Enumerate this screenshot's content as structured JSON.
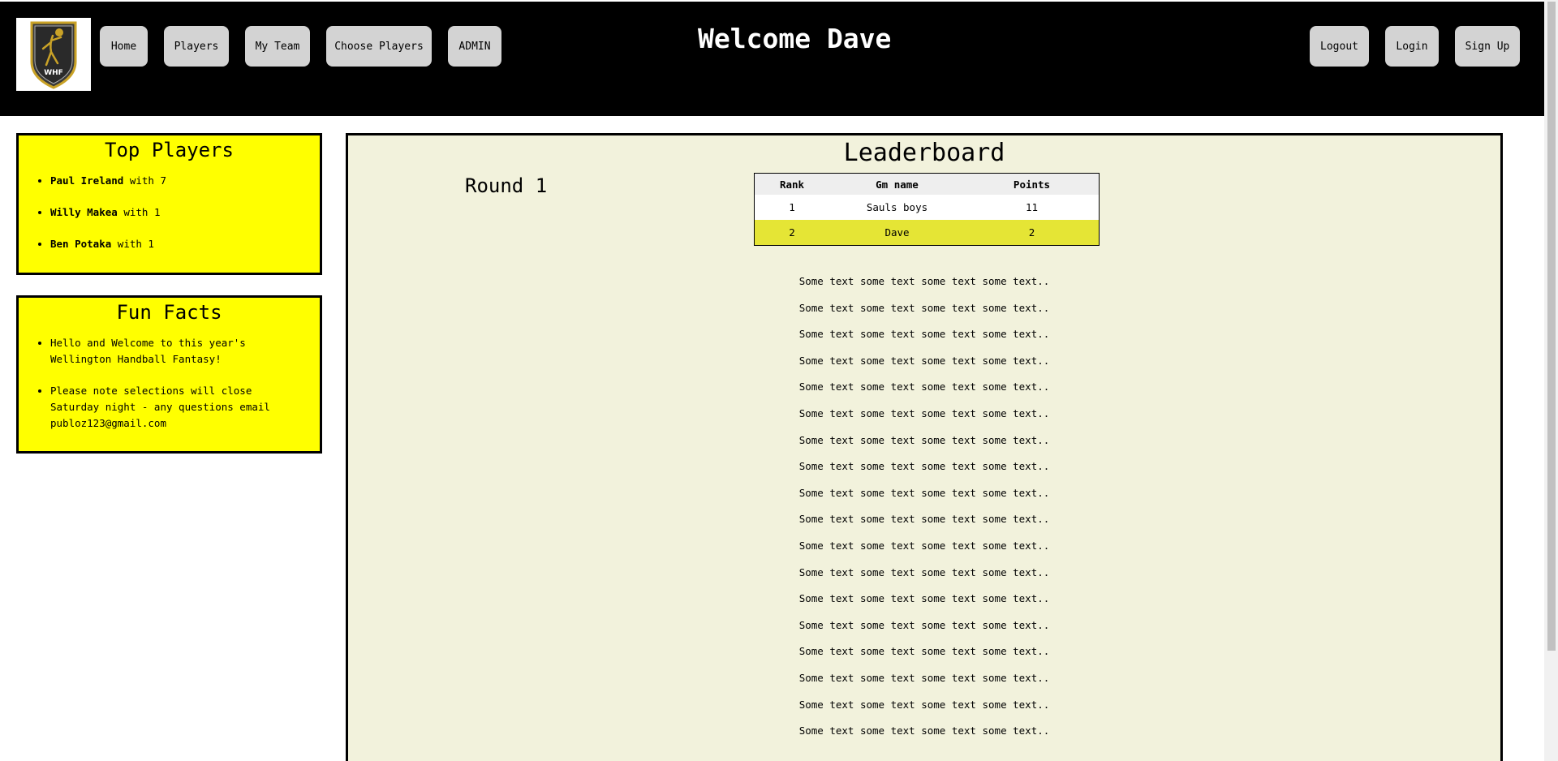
{
  "header": {
    "logo_text": "WHF",
    "welcome": "Welcome Dave",
    "nav_left": [
      "Home",
      "Players",
      "My Team",
      "Choose Players",
      "ADMIN"
    ],
    "nav_right": [
      "Logout",
      "Login",
      "Sign Up"
    ]
  },
  "top_players": {
    "title": "Top Players",
    "items": [
      {
        "name": "Paul Ireland",
        "suffix": " with 7"
      },
      {
        "name": "Willy Makea",
        "suffix": " with 1"
      },
      {
        "name": "Ben Potaka",
        "suffix": " with 1"
      }
    ]
  },
  "fun_facts": {
    "title": "Fun Facts",
    "items": [
      "Hello and Welcome to this year's Wellington Handball Fantasy!",
      "Please note selections will close Saturday night - any questions email publoz123@gmail.com"
    ]
  },
  "leaderboard": {
    "title": "Leaderboard",
    "round": "Round 1",
    "columns": [
      "Rank",
      "Gm name",
      "Points"
    ],
    "rows": [
      [
        "1",
        "Sauls boys",
        "11"
      ],
      [
        "2",
        "Dave",
        "2"
      ]
    ]
  },
  "filler_text": [
    "Some text some text some text some text..",
    "Some text some text some text some text..",
    "Some text some text some text some text..",
    "Some text some text some text some text..",
    "Some text some text some text some text..",
    "Some text some text some text some text..",
    "Some text some text some text some text..",
    "Some text some text some text some text..",
    "Some text some text some text some text..",
    "Some text some text some text some text..",
    "Some text some text some text some text..",
    "Some text some text some text some text..",
    "Some text some text some text some text..",
    "Some text some text some text some text..",
    "Some text some text some text some text..",
    "Some text some text some text some text..",
    "Some text some text some text some text..",
    "Some text some text some text some text.."
  ]
}
